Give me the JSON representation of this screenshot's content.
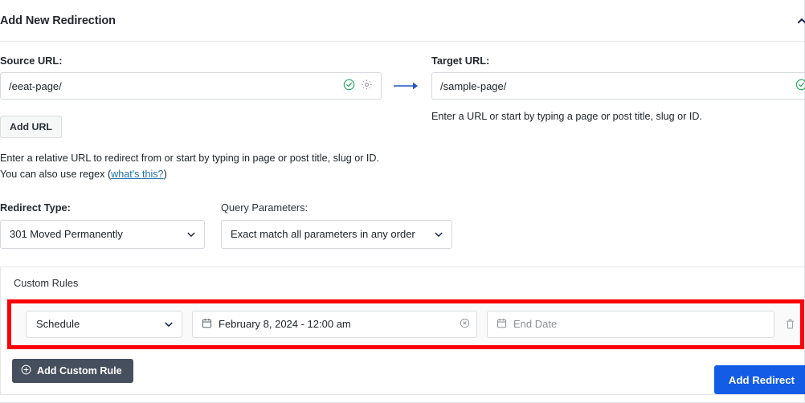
{
  "header": {
    "title": "Add New Redirection",
    "collapse_icon": "chevron-up-icon"
  },
  "source": {
    "label": "Source URL:",
    "value": "/eeat-page/",
    "valid_icon": "check-circle-icon",
    "settings_icon": "gear-icon",
    "add_url_label": "Add URL",
    "help_line1": "Enter a relative URL to redirect from or start by typing in page or post title, slug or ID.",
    "help_line2_prefix": "You can also use regex (",
    "help_link": "what's this?",
    "help_line2_suffix": ")"
  },
  "arrow": {
    "icon": "arrow-right-icon"
  },
  "target": {
    "label": "Target URL:",
    "value": "/sample-page/",
    "valid_icon": "check-circle-icon",
    "help": "Enter a URL or start by typing a page or post title, slug or ID."
  },
  "redirect_type": {
    "label": "Redirect Type:",
    "selected": "301 Moved Permanently",
    "chevron_icon": "chevron-down-icon"
  },
  "query_parameters": {
    "label": "Query Parameters:",
    "selected": "Exact match all parameters in any order",
    "chevron_icon": "chevron-down-icon"
  },
  "custom_rules": {
    "title": "Custom Rules",
    "highlight_color": "#fc0008",
    "rule": {
      "type_selected": "Schedule",
      "type_chevron_icon": "chevron-down-icon",
      "start_date_icon": "calendar-icon",
      "start_date_value": "February 8, 2024 - 12:00 am",
      "clear_icon": "clear-circle-icon",
      "end_date_icon": "calendar-icon",
      "end_date_placeholder": "End Date",
      "delete_icon": "trash-icon"
    },
    "add_rule_label": "Add Custom Rule",
    "add_rule_icon": "plus-circle-icon"
  },
  "footer": {
    "submit_label": "Add Redirect",
    "submit_color": "#135ce6"
  }
}
